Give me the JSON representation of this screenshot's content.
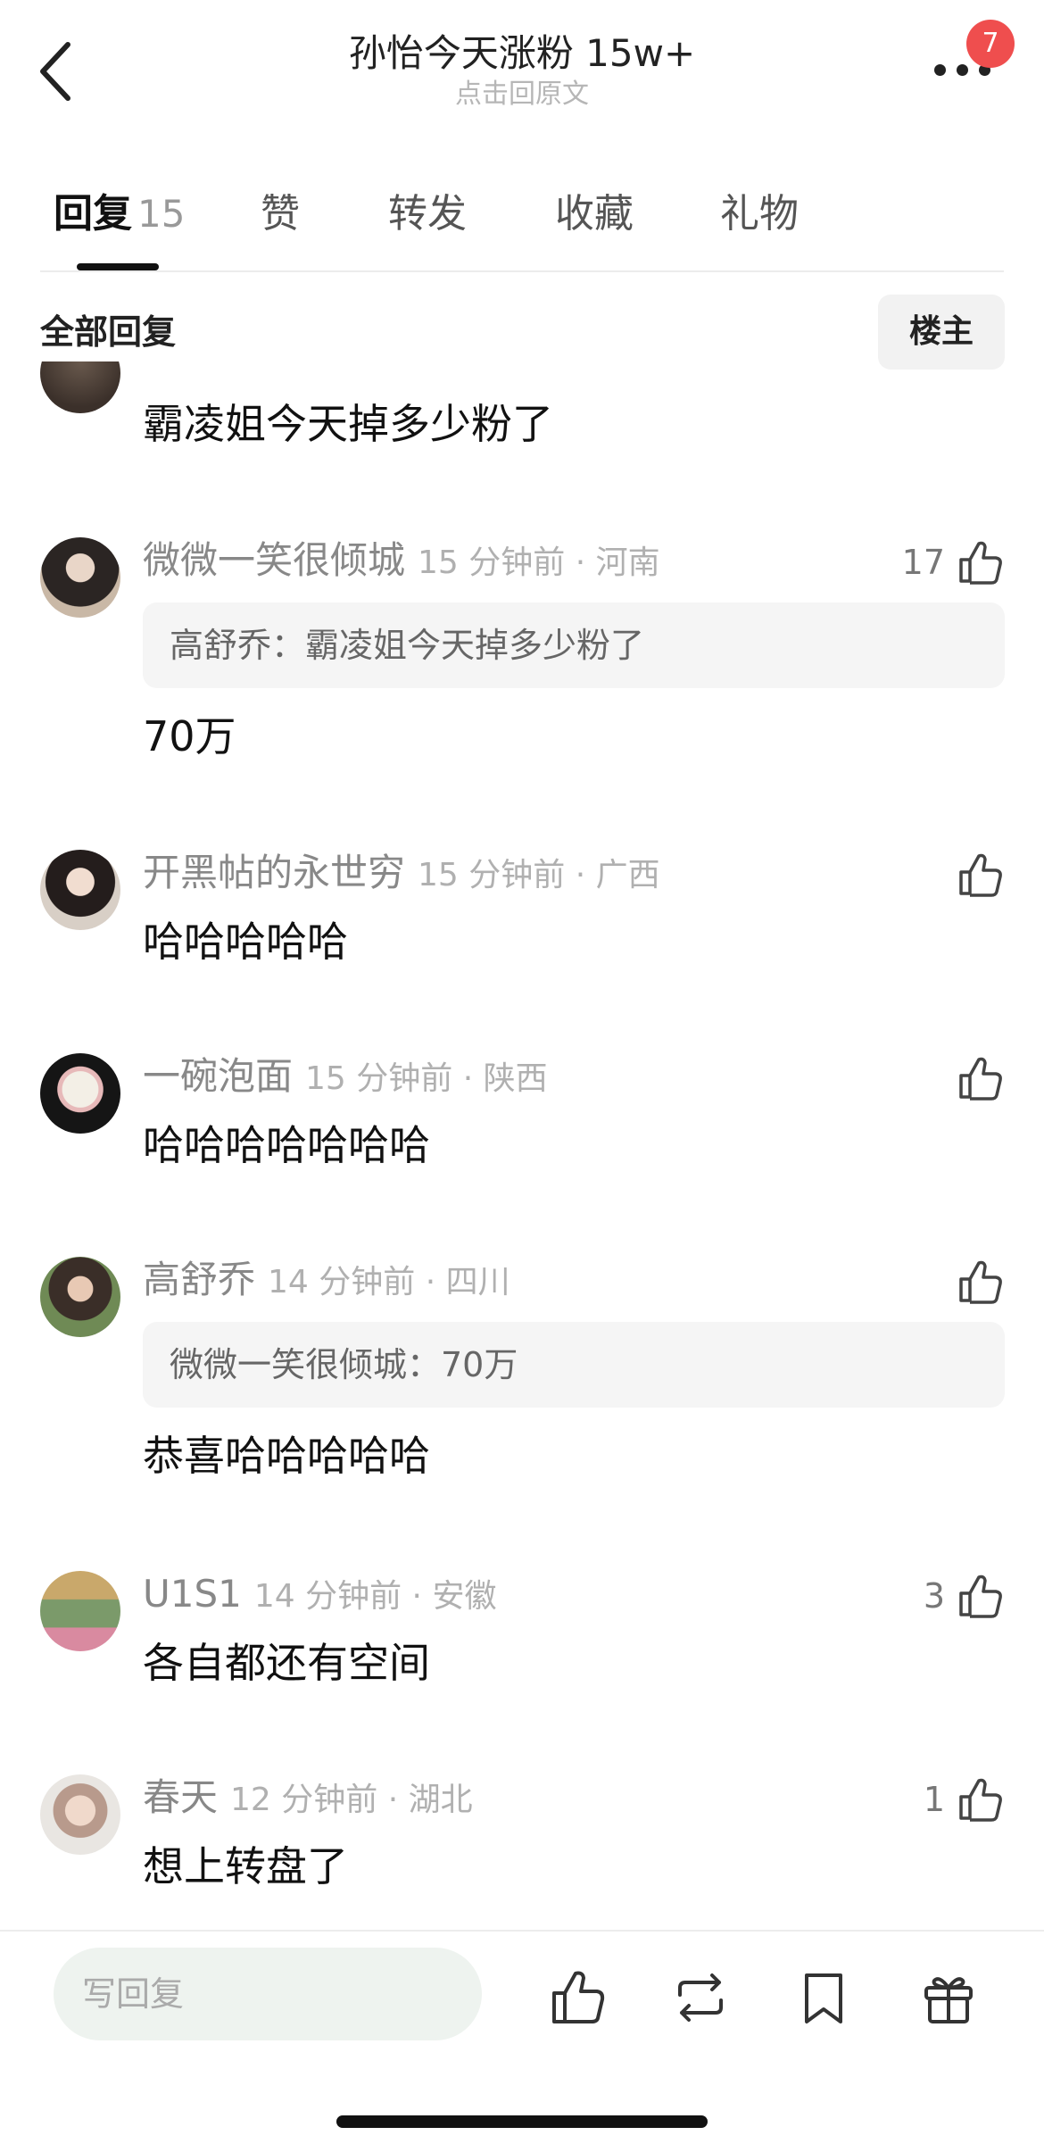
{
  "header": {
    "title": "孙怡今天涨粉 15w+",
    "subtitle": "点击回原文",
    "badge": "7",
    "icons": [
      "back-chevron-icon",
      "more-dots-icon"
    ]
  },
  "tabs": [
    {
      "label": "回复",
      "count": "15",
      "active": true
    },
    {
      "label": "赞"
    },
    {
      "label": "转发"
    },
    {
      "label": "收藏"
    },
    {
      "label": "礼物"
    }
  ],
  "filter": {
    "label": "全部回复",
    "op_button": "楼主"
  },
  "partial_comment": {
    "text": "霸凌姐今天掉多少粉了"
  },
  "comments": [
    {
      "name": "微微一笑很倾城",
      "time": "15 分钟前 · 河南",
      "likes": "17",
      "quote": "高舒乔：霸凌姐今天掉多少粉了",
      "text": "70万"
    },
    {
      "name": "开黑帖的永世穷",
      "time": "15 分钟前 · 广西",
      "likes": "",
      "text": "哈哈哈哈哈"
    },
    {
      "name": "一碗泡面",
      "time": "15 分钟前 · 陕西",
      "likes": "",
      "text": "哈哈哈哈哈哈哈"
    },
    {
      "name": "高舒乔",
      "time": "14 分钟前 · 四川",
      "likes": "",
      "quote": "微微一笑很倾城：70万",
      "text": "恭喜哈哈哈哈哈"
    },
    {
      "name": "U1S1",
      "time": "14 分钟前 · 安徽",
      "likes": "3",
      "text": "各自都还有空间"
    },
    {
      "name": "春天",
      "time": "12 分钟前 · 湖北",
      "likes": "1",
      "text": "想上转盘了"
    }
  ],
  "bottom_bar": {
    "reply_placeholder": "写回复",
    "icons": [
      "thumb-up-icon",
      "repost-icon",
      "bookmark-icon",
      "gift-icon"
    ]
  },
  "colors": {
    "badge": "#ef4e4e",
    "quote_bg": "#f5f5f5",
    "input_bg": "#eef3ef"
  }
}
